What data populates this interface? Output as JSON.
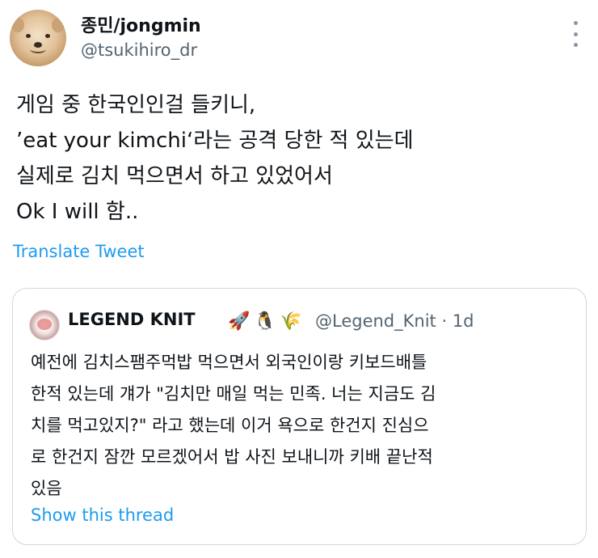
{
  "author": {
    "display_name": "종민/jongmin",
    "handle": "@tsukihiro_dr"
  },
  "tweet": {
    "lines": [
      "게임 중 한국인인걸 들키니,",
      "’eat your kimchi‘라는 공격 당한 적 있는데",
      "실제로 김치 먹으면서 하고 있었어서",
      "Ok I will 함.."
    ],
    "translate_label": "Translate Tweet"
  },
  "quote": {
    "display_name": "LEGEND KNIT",
    "emoji": [
      "🚀",
      "🐧",
      "🌾"
    ],
    "handle_time": "@Legend_Knit · 1d",
    "lines": [
      "예전에 김치스팸주먹밥 먹으면서 외국인이랑 키보드배틀",
      "한적 있는데 걔가 \"김치만 매일 먹는 민족. 너는 지금도 김",
      "치를 먹고있지?\" 라고 했는데 이거 욕으로 한건지 진심으",
      "로 한건지 잠깐 모르겠어서 밥 사진 보내니까 키배 끝난적",
      "있음"
    ],
    "show_thread_label": "Show this thread"
  },
  "icons": {
    "more": "more-options-icon"
  },
  "colors": {
    "link": "#1d9bf0",
    "secondary_text": "#536471",
    "border": "#cfd9de"
  }
}
